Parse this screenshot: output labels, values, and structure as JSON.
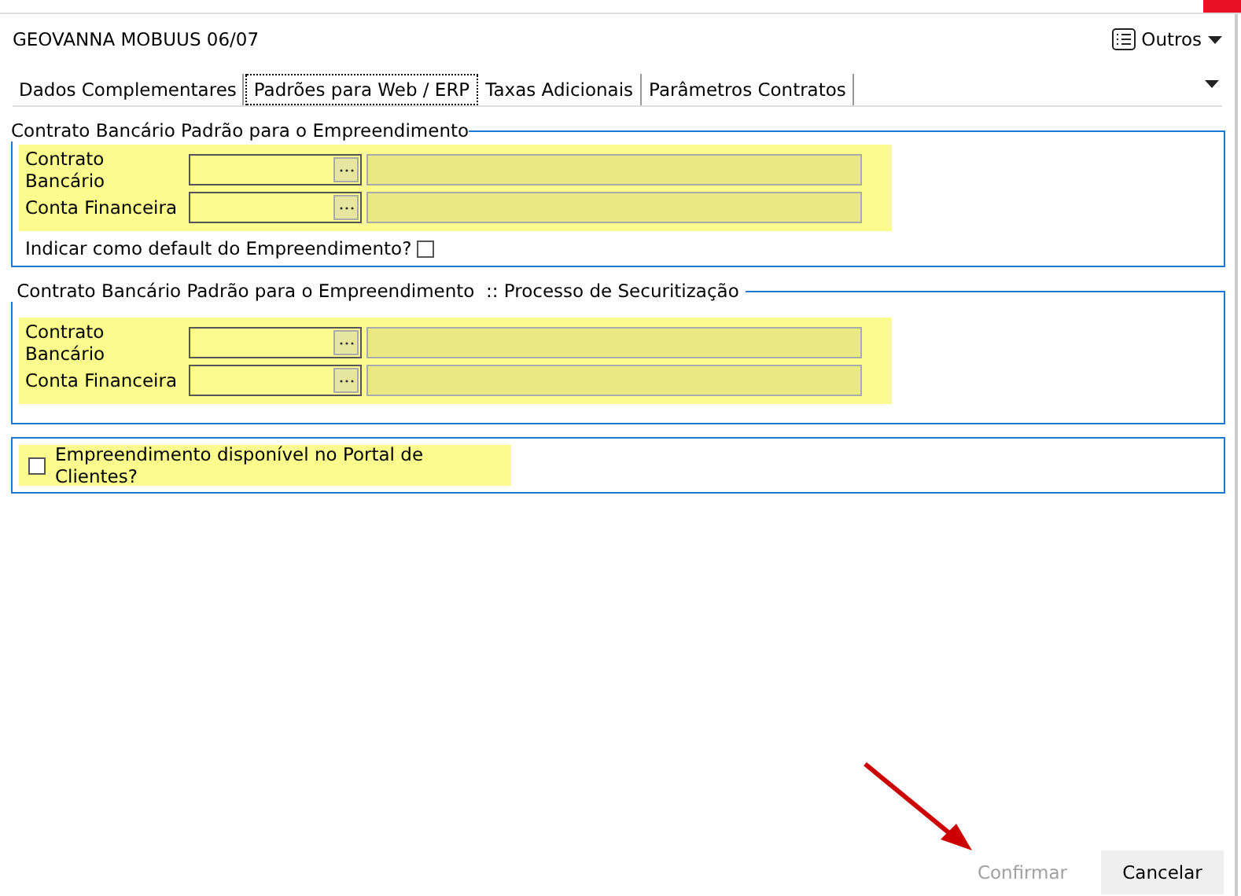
{
  "window": {
    "title": "GEOVANNA MOBUUS 06/07",
    "menu_button": "Outros"
  },
  "tabs": [
    {
      "label": "Dados Complementares",
      "selected": false
    },
    {
      "label": "Padrões para Web / ERP",
      "selected": true
    },
    {
      "label": "Taxas Adicionais",
      "selected": false
    },
    {
      "label": "Parâmetros Contratos",
      "selected": false
    }
  ],
  "groups": [
    {
      "title": "Contrato Bancário Padrão para o Empreendimento",
      "fields": [
        {
          "label": "Contrato Bancário"
        },
        {
          "label": "Conta Financeira"
        }
      ],
      "default_checkbox": {
        "label": "Indicar como default do Empreendimento?",
        "checked": false
      }
    },
    {
      "title": " Contrato Bancário Padrão para o Empreendimento  :: Processo de Securitização ",
      "fields": [
        {
          "label": "Contrato Bancário"
        },
        {
          "label": "Conta Financeira"
        }
      ]
    }
  ],
  "portal_checkbox": {
    "label": "Empreendimento disponível no Portal de Clientes?",
    "checked": false
  },
  "buttons": [
    {
      "label": "Confirmar",
      "disabled": true
    },
    {
      "label": "Cancelar",
      "disabled": false
    }
  ]
}
